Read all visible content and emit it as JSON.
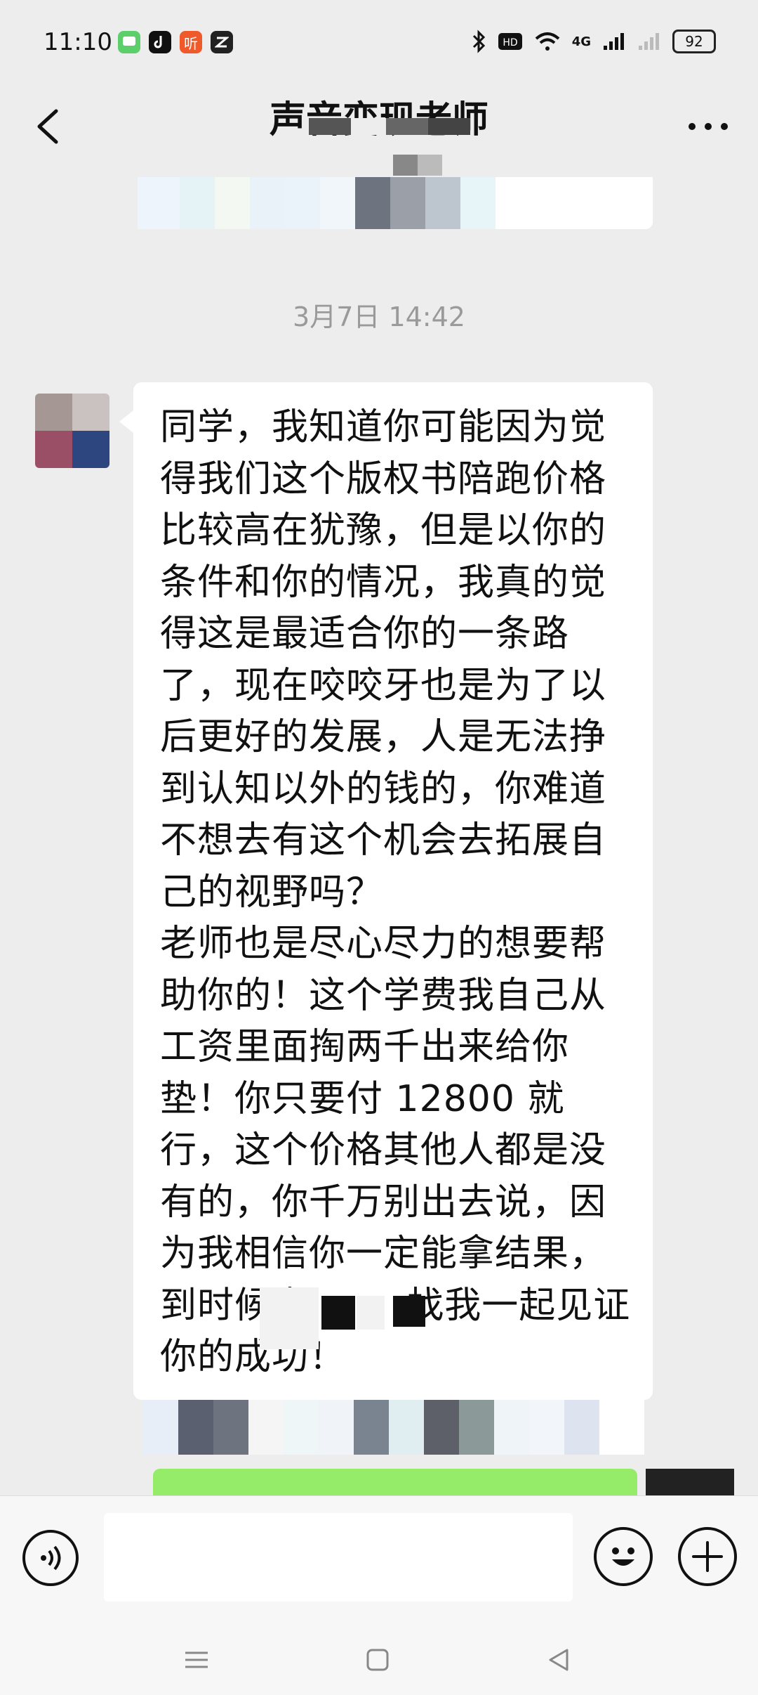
{
  "status_bar": {
    "time": "11:10",
    "battery": "92",
    "network": "4G"
  },
  "app_icons": [
    {
      "name": "message-app-icon",
      "color": "#5ccf6b"
    },
    {
      "name": "tiktok-app-icon",
      "color": "#111111"
    },
    {
      "name": "listen-app-icon",
      "color": "#f05a2a",
      "glyph": "听"
    },
    {
      "name": "tool-app-icon",
      "color": "#222222"
    }
  ],
  "header": {
    "title": "声音变现老师"
  },
  "chat": {
    "timestamp": "3月7日 14:42",
    "message_text": "同学，我知道你可能因为觉得我们这个版权书陪跑价格比较高在犹豫，但是以你的条件和你的情况，我真的觉得这是最适合你的一条路了，现在咬咬牙也是为了以后更好的发展，人是无法挣到认知以外的钱的，你难道不想去有这个机会去拓展自己的视野吗？\n老师也是尽心尽力的想要帮助你的！这个学费我自己从工资里面掏两千出来给你垫！你只要付 12800 就行，这个价格其他人都是没有的，你千万别出去说，因为我相信你一定能拿结果，到时候来        找我一起见证你的成功！"
  },
  "colors": {
    "background": "#ededed",
    "bubble_incoming": "#ffffff",
    "bubble_outgoing": "#95ec69",
    "timestamp_text": "#9a9a9a"
  }
}
